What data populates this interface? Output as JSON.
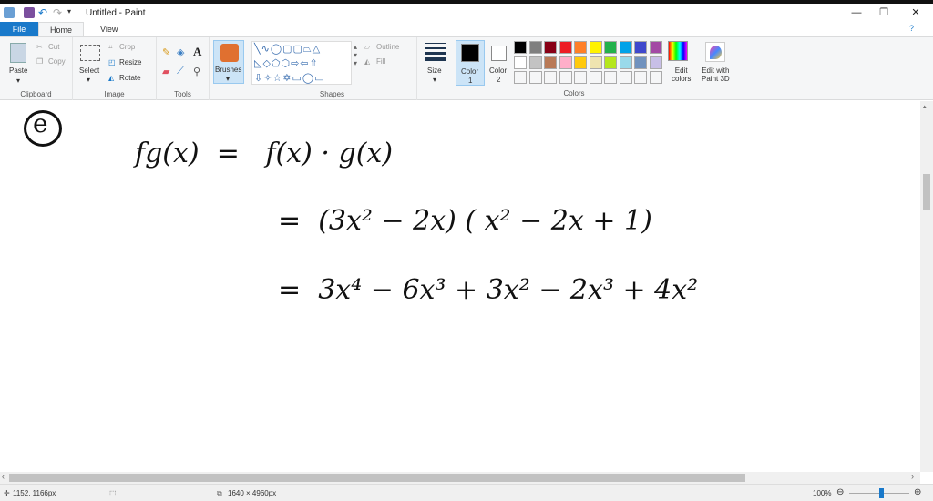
{
  "window": {
    "title": "Untitled - Paint"
  },
  "tabs": [
    {
      "label": "File"
    },
    {
      "label": "Home"
    },
    {
      "label": "View"
    }
  ],
  "clipboard": {
    "paste": "Paste",
    "cut": "Cut",
    "copy": "Copy",
    "group": "Clipboard"
  },
  "image": {
    "select": "Select",
    "crop": "Crop",
    "resize": "Resize",
    "rotate": "Rotate",
    "group": "Image"
  },
  "tools": {
    "group": "Tools",
    "brushes": "Brushes"
  },
  "shapes": {
    "group": "Shapes",
    "outline": "Outline",
    "fill": "Fill"
  },
  "size": {
    "label": "Size"
  },
  "colors": {
    "color1": "Color",
    "color1n": "1",
    "color2": "Color",
    "color2n": "2",
    "group": "Colors",
    "edit": "Edit",
    "edit2": "colors",
    "palette_row1": [
      "#000000",
      "#7f7f7f",
      "#880015",
      "#ed1c24",
      "#ff7f27",
      "#fff200",
      "#22b14c",
      "#00a2e8",
      "#3f48cc",
      "#a349a4"
    ],
    "palette_row2": [
      "#ffffff",
      "#c3c3c3",
      "#b97a57",
      "#ffaec9",
      "#ffc90e",
      "#efe4b0",
      "#b5e61d",
      "#99d9ea",
      "#7092be",
      "#c8bfe7"
    ]
  },
  "paint3d": {
    "l1": "Edit with",
    "l2": "Paint 3D"
  },
  "canvas": {
    "label": "e",
    "line1": "fg(x)  =   f(x) · g(x)",
    "line2": "=  (3x² − 2x) ( x² − 2x + 1)",
    "line3": "=  3x⁴ − 6x³ + 3x² − 2x³ + 4x²"
  },
  "status": {
    "cursor": "1152, 1166px",
    "size": "1640 × 4960px",
    "zoom": "100%"
  }
}
